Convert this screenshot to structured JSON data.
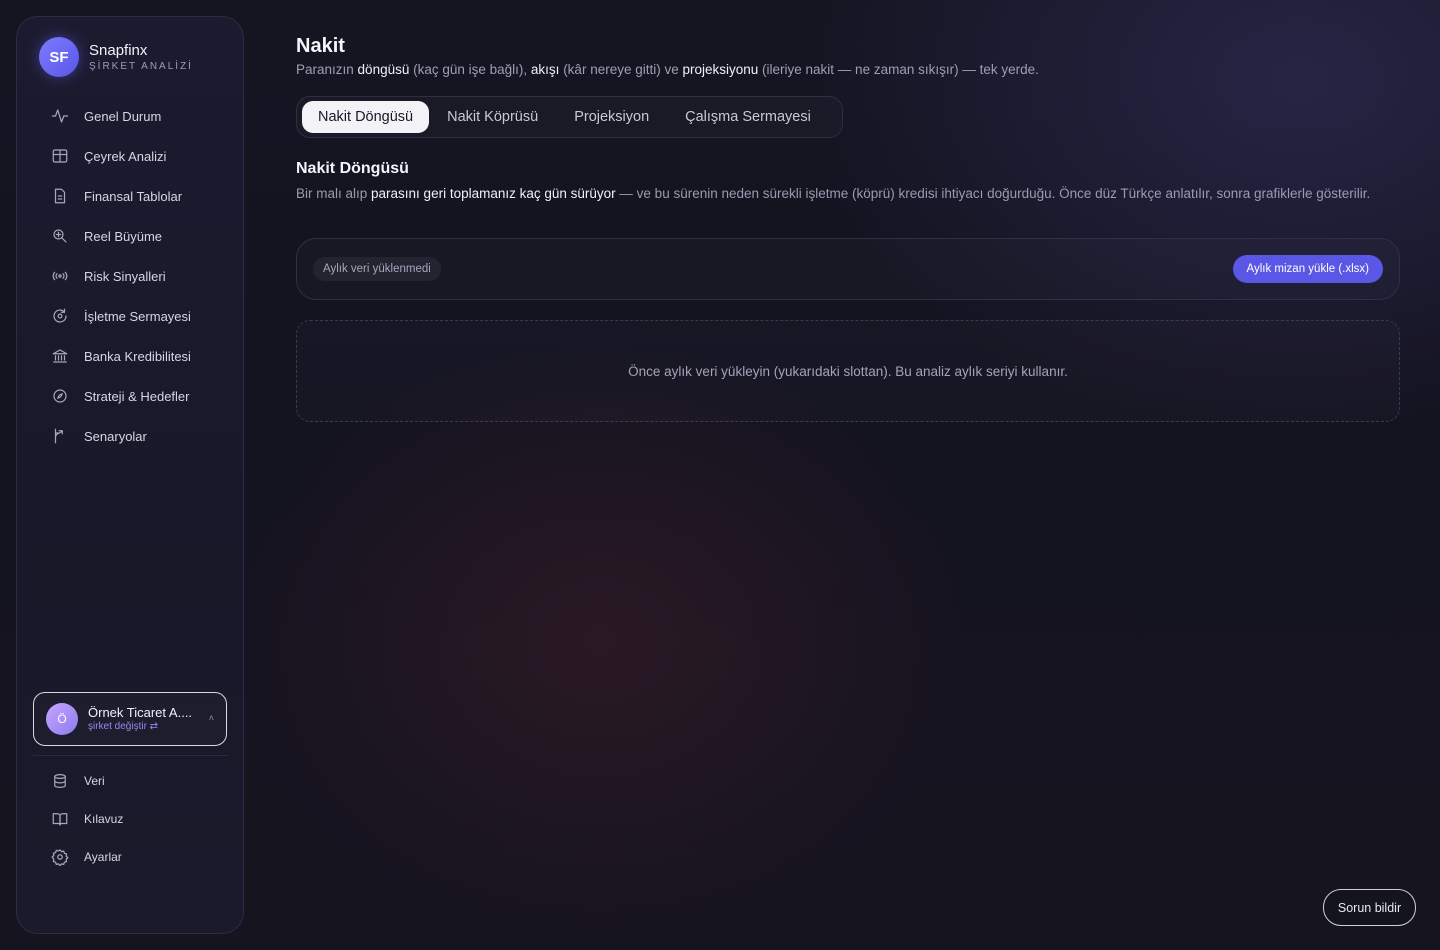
{
  "brand": {
    "initials": "SF",
    "name": "Snapfinx",
    "subtitle": "ŞİRKET ANALİZİ"
  },
  "sidebar": {
    "items": [
      {
        "label": "Genel Durum",
        "icon": "activity-icon"
      },
      {
        "label": "Çeyrek Analizi",
        "icon": "grid-icon"
      },
      {
        "label": "Finansal Tablolar",
        "icon": "document-icon"
      },
      {
        "label": "Reel Büyüme",
        "icon": "zoom-in-icon"
      },
      {
        "label": "Risk Sinyalleri",
        "icon": "signal-icon"
      },
      {
        "label": "İşletme Sermayesi",
        "icon": "cycle-icon"
      },
      {
        "label": "Banka Kredibilitesi",
        "icon": "bank-icon"
      },
      {
        "label": "Strateji & Hedefler",
        "icon": "compass-icon"
      },
      {
        "label": "Senaryolar",
        "icon": "branch-icon"
      }
    ],
    "company": {
      "initial": "Ö",
      "name": "Örnek Ticaret A....",
      "switch_label": "şirket değiştir ⇄",
      "chevron": "˄"
    },
    "bottom_items": [
      {
        "label": "Veri",
        "icon": "database-icon"
      },
      {
        "label": "Kılavuz",
        "icon": "book-icon"
      },
      {
        "label": "Ayarlar",
        "icon": "gear-icon"
      }
    ]
  },
  "header": {
    "title": "Nakit",
    "desc": {
      "p1": "Paranızın ",
      "b1": "döngüsü",
      "p2": " (kaç gün işe bağlı), ",
      "b2": "akışı",
      "p3": " (kâr nereye gitti) ve ",
      "b3": "projeksiyonu",
      "p4": " (ileriye nakit — ne zaman sıkışır) — tek yerde."
    }
  },
  "tabs": [
    {
      "label": "Nakit Döngüsü",
      "active": true
    },
    {
      "label": "Nakit Köprüsü",
      "active": false
    },
    {
      "label": "Projeksiyon",
      "active": false
    },
    {
      "label": "Çalışma Sermayesi",
      "active": false
    }
  ],
  "section": {
    "title": "Nakit Döngüsü",
    "desc": {
      "p1": "Bir malı alıp ",
      "b1": "parasını geri toplamanız kaç gün sürüyor",
      "p2": " — ve bu sürenin neden sürekli işletme (köprü) kredisi ihtiyacı doğurduğu. Önce düz Türkçe anlatılır, sonra grafiklerle gösterilir."
    }
  },
  "upload": {
    "status": "Aylık veri yüklenmedi",
    "button_label": "Aylık mizan yükle (.xlsx)"
  },
  "empty_state": {
    "message": "Önce aylık veri yükleyin (yukarıdaki slottan). Bu analiz aylık seriyi kullanır."
  },
  "report_button": {
    "label": "Sorun bildir"
  },
  "colors": {
    "accent": "#5b57e6",
    "background": "#151522"
  }
}
